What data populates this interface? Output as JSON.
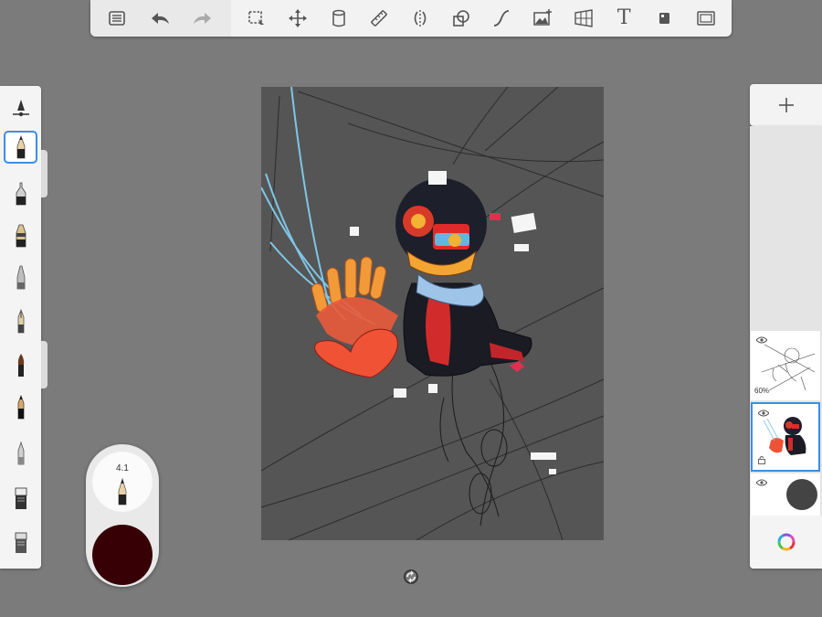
{
  "toolbar": {
    "items": [
      {
        "name": "list-icon"
      },
      {
        "name": "undo-icon"
      },
      {
        "name": "redo-icon"
      },
      {
        "name": "selection-icon"
      },
      {
        "name": "transform-icon"
      },
      {
        "name": "fill-icon"
      },
      {
        "name": "ruler-icon"
      },
      {
        "name": "symmetry-icon"
      },
      {
        "name": "shape-icon"
      },
      {
        "name": "curve-icon"
      },
      {
        "name": "image-icon"
      },
      {
        "name": "perspective-icon"
      },
      {
        "name": "text-icon",
        "label": "T"
      },
      {
        "name": "tool-icon"
      },
      {
        "name": "fullscreen-icon"
      }
    ]
  },
  "brush_puck": {
    "size": "4.1",
    "color": "#360004"
  },
  "layers": {
    "items": [
      {
        "name": "sketch-layer",
        "opacity": "60%"
      },
      {
        "name": "color-layer",
        "selected": true
      },
      {
        "name": "background-layer",
        "swatch": "#444444"
      }
    ]
  },
  "colors": {
    "accent": "#3b8ee8",
    "canvas_bg": "#555555",
    "app_bg": "#7b7b7b"
  }
}
